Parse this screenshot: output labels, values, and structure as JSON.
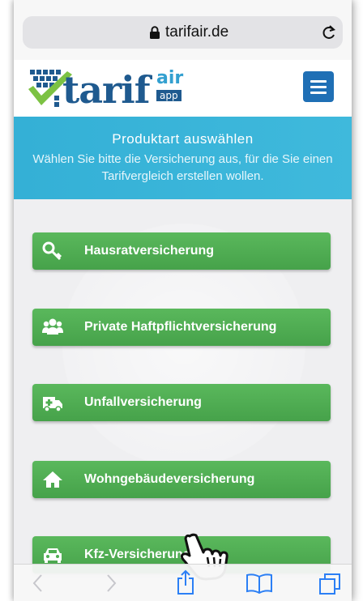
{
  "browser": {
    "url": "tarifair.de",
    "lock_icon": "lock-icon",
    "reload_icon": "reload-icon",
    "toolbar": [
      "back-icon",
      "forward-icon",
      "share-icon",
      "bookmarks-icon",
      "tabs-icon"
    ]
  },
  "header": {
    "logo_word": "tari",
    "logo_fa": "f",
    "logo_air": "air",
    "logo_app": "app",
    "menu_icon": "hamburger-menu-icon"
  },
  "banner": {
    "title": "Produktart auswählen",
    "subtitle": "Wählen Sie bitte die Versicherung aus, für die Sie einen Tarifvergleich erstellen wollen."
  },
  "products": [
    {
      "label": "Hausratversicherung",
      "icon": "key-icon"
    },
    {
      "label": "Private Haftpflichtversicherung",
      "icon": "users-icon"
    },
    {
      "label": "Unfallversicherung",
      "icon": "ambulance-icon"
    },
    {
      "label": "Wohngebäudeversicherung",
      "icon": "home-icon"
    },
    {
      "label": "Kfz-Versicherung",
      "icon": "car-icon"
    }
  ],
  "colors": {
    "brand_blue": "#1f5a8f",
    "banner": "#38b3d8",
    "button_green": "#4fae52"
  }
}
